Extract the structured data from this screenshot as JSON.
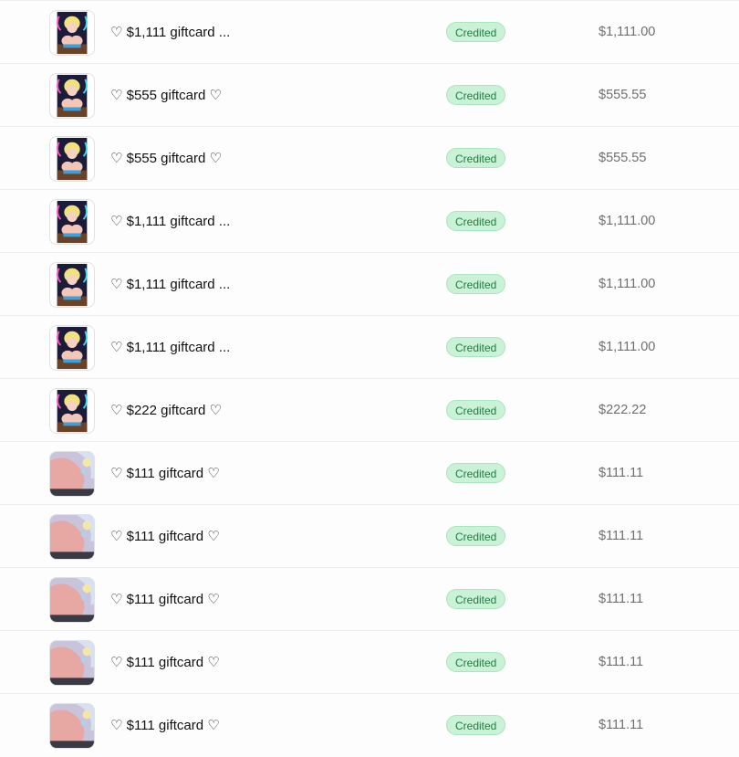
{
  "transactions": [
    {
      "title": "♡ $1,111 giftcard ...",
      "status": "Credited",
      "amount": "$1,111.00",
      "thumb": "anime-art-dark"
    },
    {
      "title": "♡ $555 giftcard ♡",
      "status": "Credited",
      "amount": "$555.55",
      "thumb": "anime-art-dark"
    },
    {
      "title": "♡ $555 giftcard ♡",
      "status": "Credited",
      "amount": "$555.55",
      "thumb": "anime-art-dark"
    },
    {
      "title": "♡ $1,111 giftcard ...",
      "status": "Credited",
      "amount": "$1,111.00",
      "thumb": "anime-art-dark"
    },
    {
      "title": "♡ $1,111 giftcard ...",
      "status": "Credited",
      "amount": "$1,111.00",
      "thumb": "anime-art-dark"
    },
    {
      "title": "♡ $1,111 giftcard ...",
      "status": "Credited",
      "amount": "$1,111.00",
      "thumb": "anime-art-dark"
    },
    {
      "title": "♡ $222 giftcard ♡",
      "status": "Credited",
      "amount": "$222.22",
      "thumb": "anime-art-dark"
    },
    {
      "title": "♡ $111 giftcard ♡",
      "status": "Credited",
      "amount": "$111.11",
      "thumb": "anime-art-pink"
    },
    {
      "title": "♡ $111 giftcard ♡",
      "status": "Credited",
      "amount": "$111.11",
      "thumb": "anime-art-pink"
    },
    {
      "title": "♡ $111 giftcard ♡",
      "status": "Credited",
      "amount": "$111.11",
      "thumb": "anime-art-pink"
    },
    {
      "title": "♡ $111 giftcard ♡",
      "status": "Credited",
      "amount": "$111.11",
      "thumb": "anime-art-pink"
    },
    {
      "title": "♡ $111 giftcard ♡",
      "status": "Credited",
      "amount": "$111.11",
      "thumb": "anime-art-pink"
    }
  ],
  "colors": {
    "badge_bg": "#c9f2d6",
    "badge_text": "#237a43",
    "amount_text": "#6f6f6f"
  }
}
